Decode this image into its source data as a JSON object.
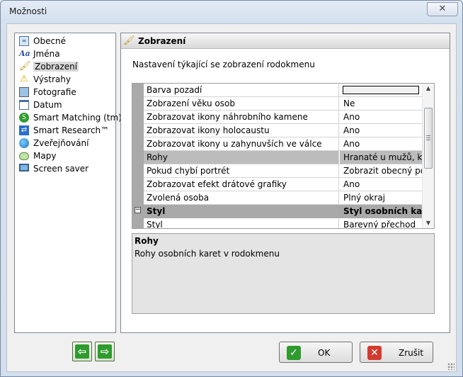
{
  "window": {
    "title": "Možnosti"
  },
  "nav": {
    "items": [
      {
        "label": "Obecné",
        "icon": "general-icon",
        "selected": false
      },
      {
        "label": "Jména",
        "icon": "names-icon",
        "selected": false
      },
      {
        "label": "Zobrazení",
        "icon": "brush-icon",
        "selected": true
      },
      {
        "label": "Výstrahy",
        "icon": "warning-icon",
        "selected": false
      },
      {
        "label": "Fotografie",
        "icon": "photo-icon",
        "selected": false
      },
      {
        "label": "Datum",
        "icon": "calendar-icon",
        "selected": false
      },
      {
        "label": "Smart Matching (tm)",
        "icon": "smart-matching-icon",
        "selected": false
      },
      {
        "label": "Smart Research™",
        "icon": "smart-research-icon",
        "selected": false
      },
      {
        "label": "Zveřejňování",
        "icon": "publish-icon",
        "selected": false
      },
      {
        "label": "Mapy",
        "icon": "map-icon",
        "selected": false
      },
      {
        "label": "Screen saver",
        "icon": "screen-saver-icon",
        "selected": false
      }
    ]
  },
  "panel": {
    "title": "Zobrazení",
    "description": "Nastavení týkající se zobrazení rodokmenu"
  },
  "properties": {
    "rows": [
      {
        "name": "Barva pozadí",
        "value": "",
        "type": "color",
        "color": "#f0f0f0"
      },
      {
        "name": "Zobrazení věku osob",
        "value": "Ne"
      },
      {
        "name": "Zobrazovat ikony náhrobního kamene",
        "value": "Ano"
      },
      {
        "name": "Zobrazovat ikony holocaustu",
        "value": "Ano"
      },
      {
        "name": "Zobrazovat ikony u zahynuvších ve válce",
        "value": "Ano"
      },
      {
        "name": "Rohy",
        "value": "Hranaté u mužů, k...",
        "selected": true
      },
      {
        "name": "Pokud chybí portrét",
        "value": "Zobrazit obecný po..."
      },
      {
        "name": "Zobrazovat efekt drátové grafiky",
        "value": "Ano"
      },
      {
        "name": "Zvolená osoba",
        "value": "Plný okraj"
      },
      {
        "name": "Styl",
        "value": "Styl osobních karet",
        "category": true
      },
      {
        "name": "Styl",
        "value": "Barevný přechod"
      }
    ]
  },
  "help": {
    "title": "Rohy",
    "text": "Rohy osobních karet v rodokmenu"
  },
  "buttons": {
    "ok": "OK",
    "cancel": "Zrušit"
  },
  "colors": {
    "selected_row": "#bcbcbc",
    "category_row": "#a9a9a9",
    "nav_icon_green": "#2f9b2f",
    "cancel_red": "#d43b2e"
  }
}
